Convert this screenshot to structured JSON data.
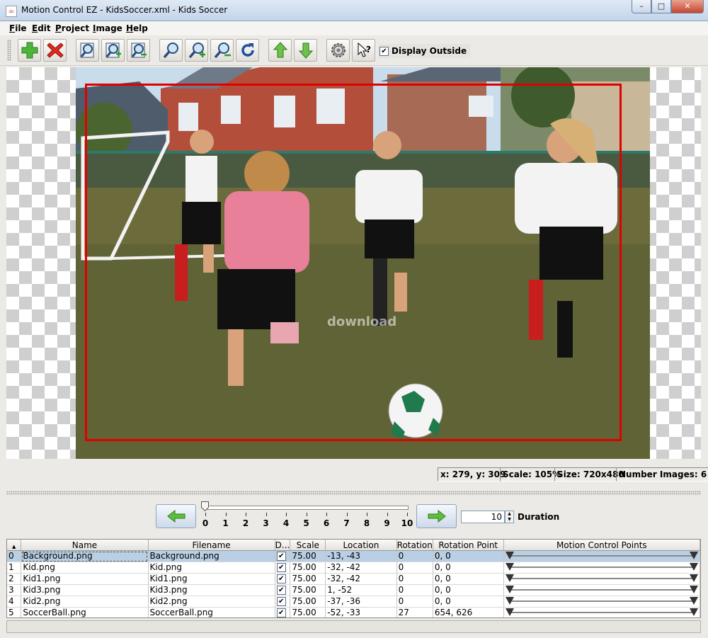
{
  "window": {
    "title": "Motion Control EZ - KidsSoccer.xml - Kids Soccer",
    "controls": [
      "–",
      "□",
      "✕"
    ]
  },
  "menu": [
    "File",
    "Edit",
    "Project",
    "Image",
    "Help"
  ],
  "toolbar": {
    "icons": [
      "add-icon",
      "delete-icon",
      "zoom-image-icon",
      "zoom-in-image-icon",
      "zoom-out-image-icon",
      "zoom-icon",
      "zoom-in-icon",
      "zoom-out-icon",
      "refresh-icon",
      "move-up-icon",
      "move-down-icon",
      "settings-icon",
      "help-pointer-icon"
    ],
    "display_outside_label": "Display Outside",
    "display_outside_checked": "✔"
  },
  "canvas": {
    "watermark": "download"
  },
  "status": {
    "coords": "x:  279, y:  309",
    "scale": "Scale: 105%",
    "size": "Size: 720x480",
    "number_images": "Number Images:  6"
  },
  "timeline": {
    "ticks": [
      "0",
      "1",
      "2",
      "3",
      "4",
      "5",
      "6",
      "7",
      "8",
      "9",
      "10"
    ],
    "value": 0,
    "max": 10,
    "duration_value": "10",
    "duration_label": "Duration"
  },
  "table": {
    "columns": [
      "",
      "Name",
      "Filename",
      "D...",
      "Scale",
      "Location",
      "Rotation",
      "Rotation Point",
      "Motion Control Points"
    ],
    "rows": [
      {
        "idx": "0",
        "name": "Background.png",
        "filename": "Background.png",
        "d": "✔",
        "scale": "75.00",
        "location": "-13, -43",
        "rotation": "0",
        "rotation_point": "0, 0"
      },
      {
        "idx": "1",
        "name": "Kid.png",
        "filename": "Kid.png",
        "d": "✔",
        "scale": "75.00",
        "location": "-32, -42",
        "rotation": "0",
        "rotation_point": "0, 0"
      },
      {
        "idx": "2",
        "name": "Kid1.png",
        "filename": "Kid1.png",
        "d": "✔",
        "scale": "75.00",
        "location": "-32, -42",
        "rotation": "0",
        "rotation_point": "0, 0"
      },
      {
        "idx": "3",
        "name": "Kid3.png",
        "filename": "Kid3.png",
        "d": "✔",
        "scale": "75.00",
        "location": "1, -52",
        "rotation": "0",
        "rotation_point": "0, 0"
      },
      {
        "idx": "4",
        "name": "Kid2.png",
        "filename": "Kid2.png",
        "d": "✔",
        "scale": "75.00",
        "location": "-37, -36",
        "rotation": "0",
        "rotation_point": "0, 0"
      },
      {
        "idx": "5",
        "name": "SoccerBall.png",
        "filename": "SoccerBall.png",
        "d": "✔",
        "scale": "75.00",
        "location": "-52, -33",
        "rotation": "27",
        "rotation_point": "654, 626"
      }
    ]
  }
}
